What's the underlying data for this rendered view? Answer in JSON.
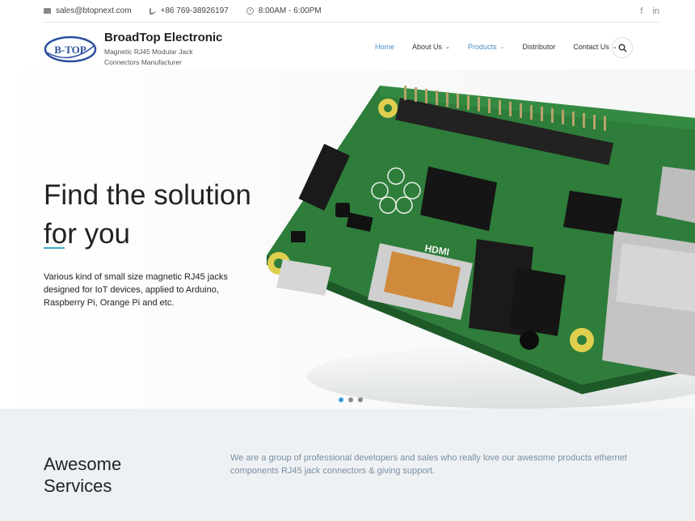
{
  "topbar": {
    "email": "sales@btopnext.com",
    "phone": "+86 769-38926197",
    "hours": "8:00AM - 6:00PM",
    "social": [
      "f",
      "in"
    ]
  },
  "header": {
    "logo_text": "B-TOP",
    "brand": "BroadTop Electronic",
    "tagline": "Magnetic RJ45 Modular Jack Connectors Manufacturer"
  },
  "nav": {
    "items": [
      {
        "label": "Home"
      },
      {
        "label": "About Us"
      },
      {
        "label": "Products"
      },
      {
        "label": "Distributor"
      },
      {
        "label": "Contact Us"
      }
    ]
  },
  "hero": {
    "title_line1": "Find the solution",
    "title_line2": "for you",
    "description": "Various kind of small size magnetic RJ45 jacks designed for IoT devices, applied to Arduino, Raspberry Pi, Orange Pi and etc.",
    "hdmi_text": "HDMI"
  },
  "services": {
    "title_line1": "Awesome",
    "title_line2": "Services",
    "description": "We are a group of professional developers and sales who really love our awesome products ethernet components RJ45 jack connectors & giving support."
  },
  "colors": {
    "accent": "#3bb0c9",
    "nav_active": "#4a90c8",
    "board_green": "#2e7d3a"
  }
}
